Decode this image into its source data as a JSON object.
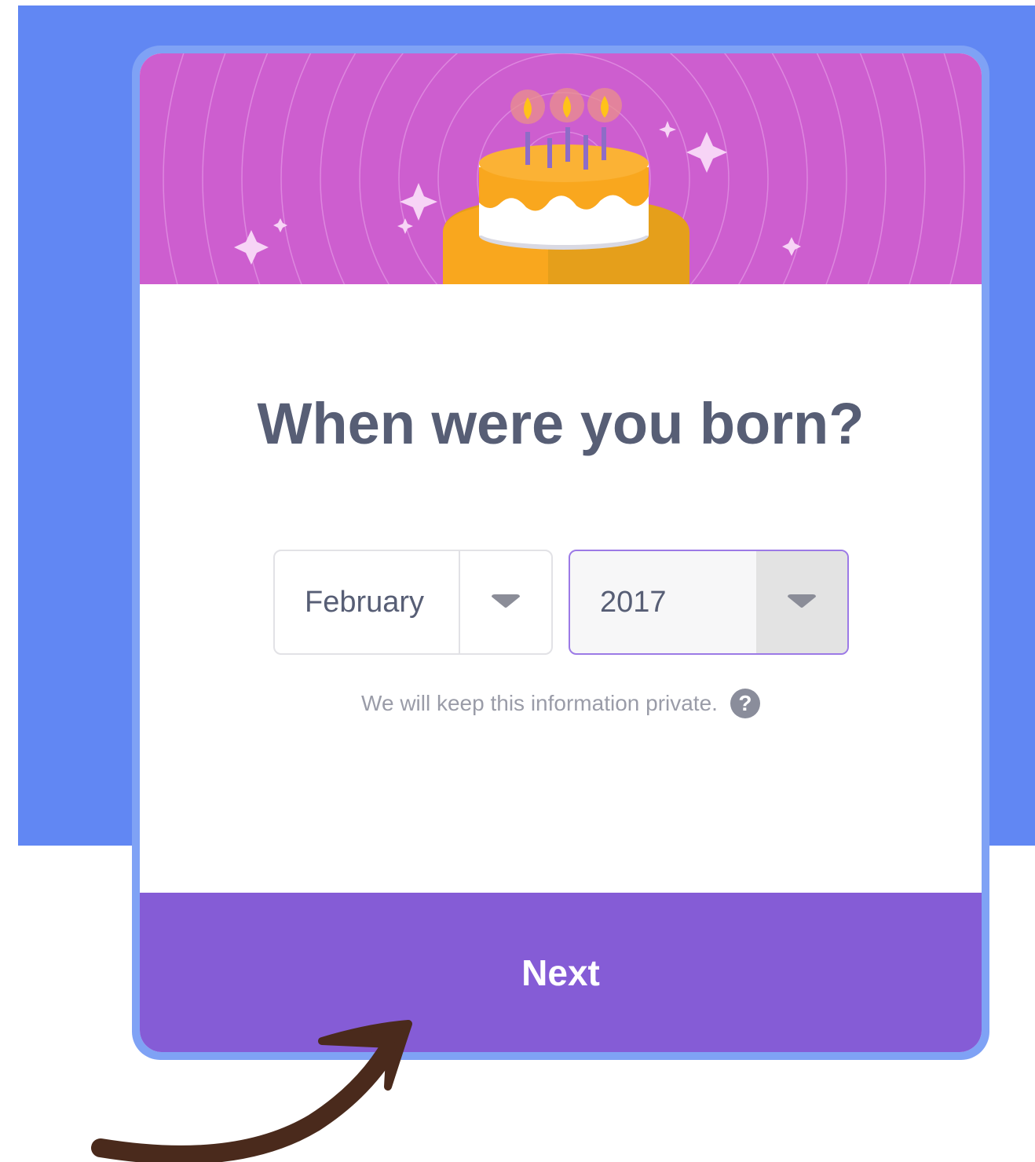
{
  "modal": {
    "title": "When were you born?",
    "month_select": {
      "value": "February"
    },
    "year_select": {
      "value": "2017"
    },
    "privacy_text": "We will keep this information private.",
    "help_icon_glyph": "?",
    "next_label": "Next"
  },
  "colors": {
    "backdrop": "#6187f3",
    "banner": "#cd5ecf",
    "next_button": "#855cd6",
    "cake": "#f9a71e",
    "annotation_arrow": "#4a2a1c"
  },
  "icons": [
    "birthday-cake-icon",
    "sparkle-icon",
    "candle-flame-icon",
    "chevron-down-icon",
    "help-icon",
    "hand-drawn-arrow"
  ]
}
